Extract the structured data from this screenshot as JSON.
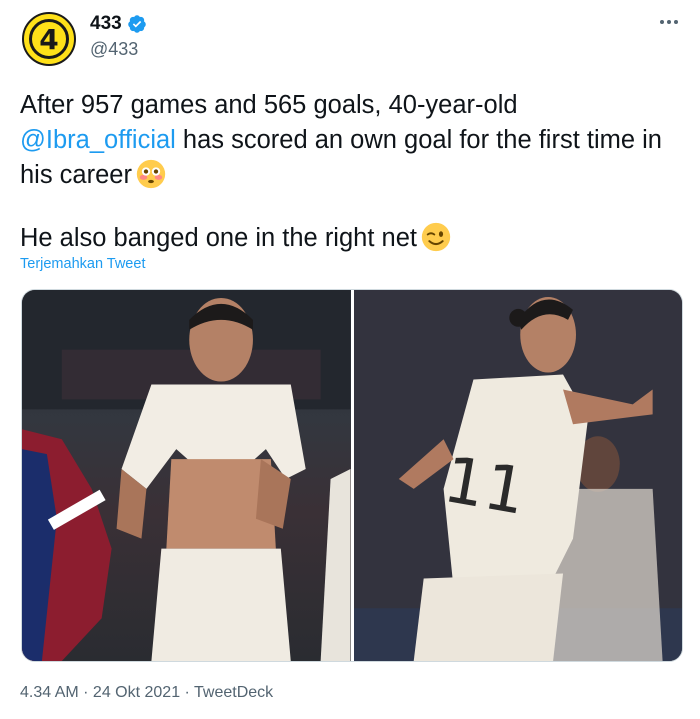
{
  "account": {
    "display_name": "433",
    "handle": "@433",
    "avatar_text": "4",
    "verified": true
  },
  "tweet": {
    "line1_before": "After 957 games and 565 goals, 40-year-old ",
    "mention": "@Ibra_official",
    "line1_after": " has scored an own goal for the first time in his career",
    "emoji1": "flushed-face",
    "line2": "He also banged one in the right net",
    "emoji2": "winking-face",
    "translate_label": "Terjemahkan Tweet"
  },
  "media": {
    "photo_count": 2
  },
  "meta": {
    "time": "4.34 AM",
    "separator": " · ",
    "date": "24 Okt 2021",
    "source": "TweetDeck"
  },
  "colors": {
    "link": "#1d9bf0",
    "secondary_text": "#536471",
    "avatar_yellow": "#ffe119"
  }
}
